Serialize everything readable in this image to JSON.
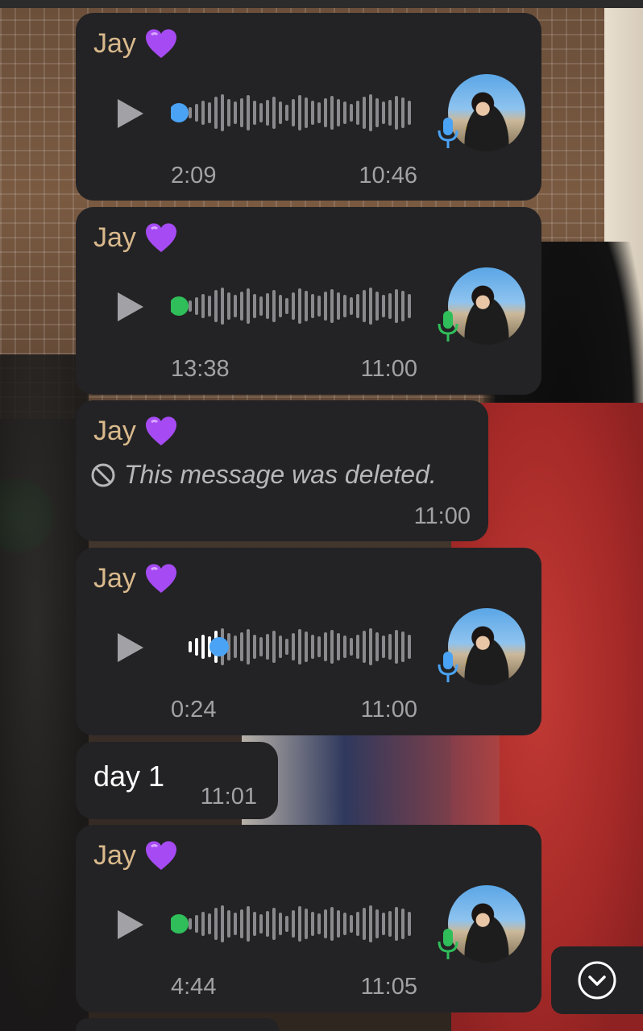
{
  "messages": [
    {
      "type": "voice",
      "sender": "Jay",
      "duration": "2:09",
      "time": "10:46",
      "played": false,
      "dot_color": "#4aa3f5",
      "mic_color": "#4aa3f5"
    },
    {
      "type": "voice",
      "sender": "Jay",
      "duration": "13:38",
      "time": "11:00",
      "played": false,
      "dot_color": "#2fbe5a",
      "mic_color": "#2fbe5a"
    },
    {
      "type": "deleted",
      "sender": "Jay",
      "text": "This message was deleted.",
      "time": "11:00"
    },
    {
      "type": "voice",
      "sender": "Jay",
      "duration": "0:24",
      "time": "11:00",
      "played": true,
      "progress": 0.15,
      "dot_color": "#4aa3f5",
      "mic_color": "#4aa3f5"
    },
    {
      "type": "text",
      "text": "day 1",
      "time": "11:01"
    },
    {
      "type": "voice",
      "sender": "Jay",
      "duration": "4:44",
      "time": "11:05",
      "played": false,
      "dot_color": "#2fbe5a",
      "mic_color": "#2fbe5a"
    }
  ],
  "icons": {
    "heart": "purple-heart-emoji",
    "play": "play-icon",
    "mic": "microphone-icon",
    "deleted": "prohibited-icon",
    "scroll": "chevron-down-circle-icon"
  },
  "colors": {
    "bubble": "#232325",
    "sender": "#d9b98c",
    "heart": "#a64bf4",
    "meta": "#a2a2a6",
    "wave": "#8a8a8e",
    "wave_played": "#ffffff"
  }
}
